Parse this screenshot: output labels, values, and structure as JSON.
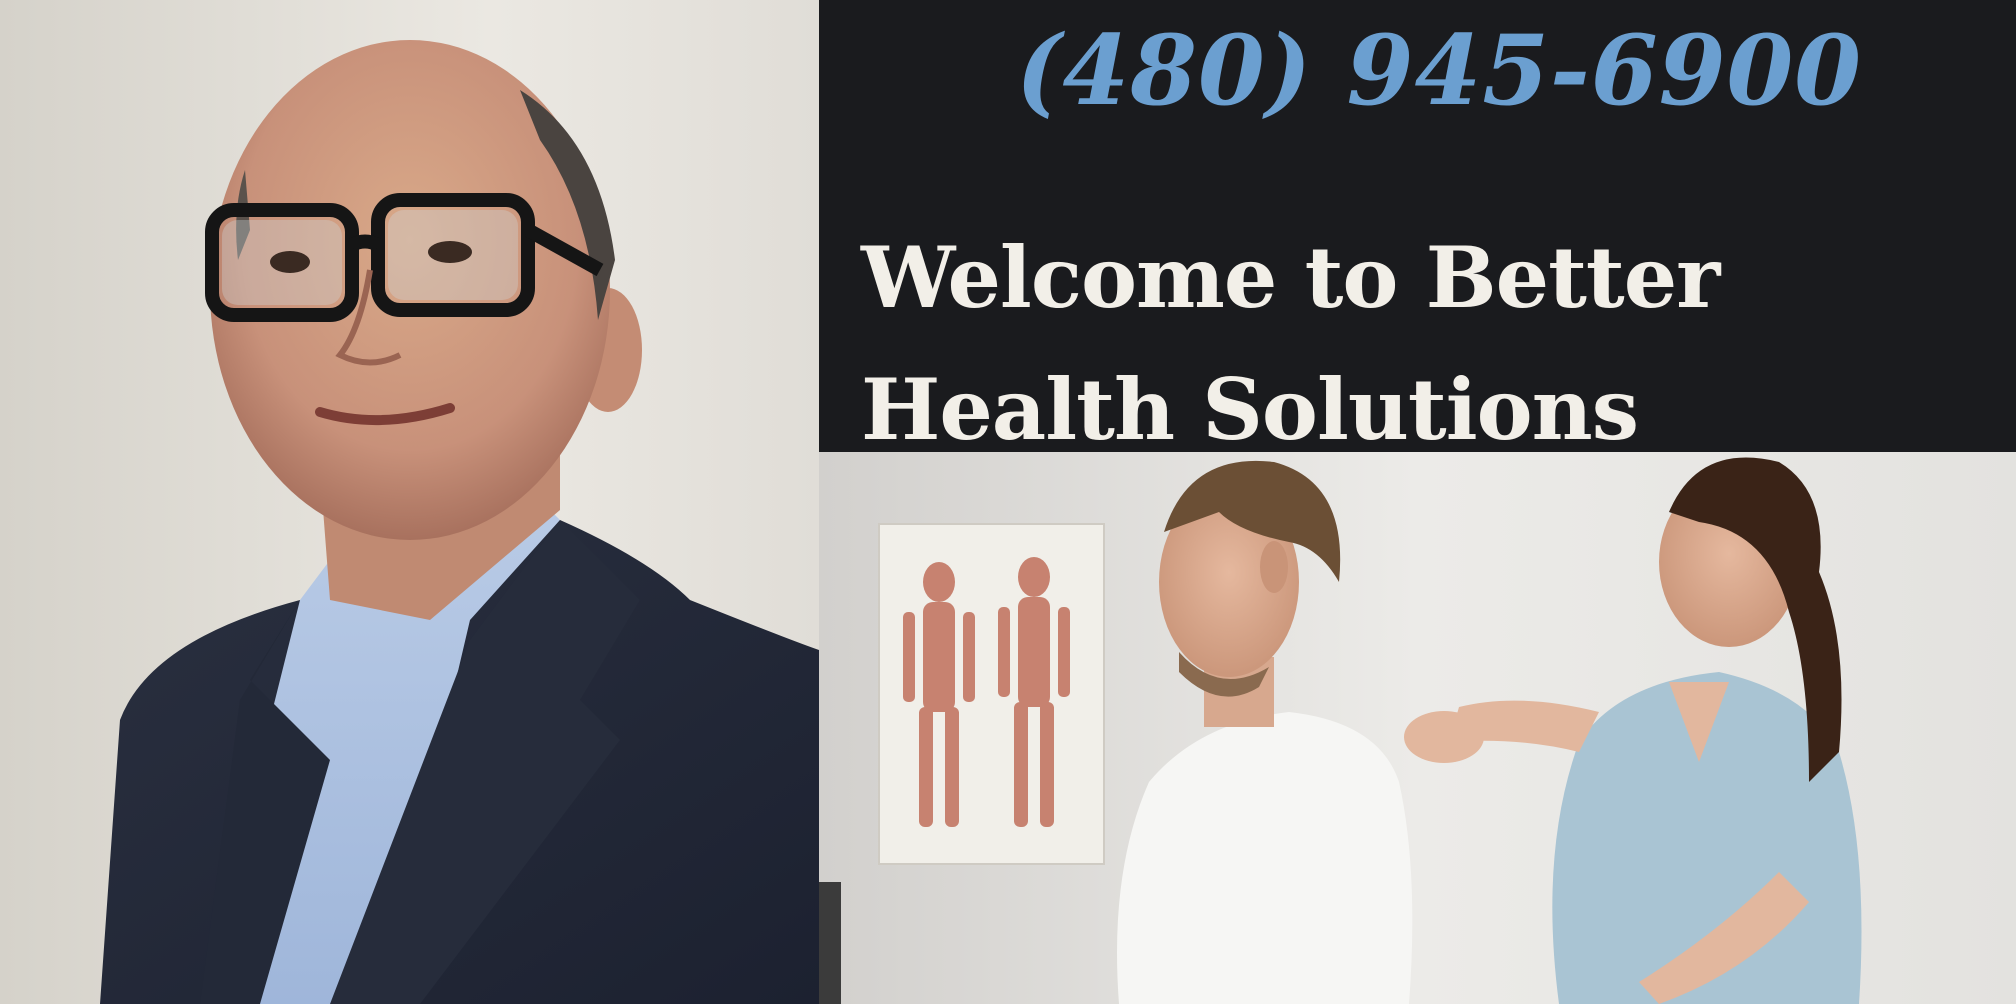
{
  "banner": {
    "phone": "(480) 945-6900",
    "welcome": "Welcome to Better Health Solutions"
  },
  "colors": {
    "banner_background": "#1a1b1e",
    "phone_text": "#6b9fd0",
    "welcome_text": "#f2efe8"
  },
  "images": {
    "portrait": "portrait-photo",
    "clinic": "chiropractic-adjustment-photo"
  }
}
